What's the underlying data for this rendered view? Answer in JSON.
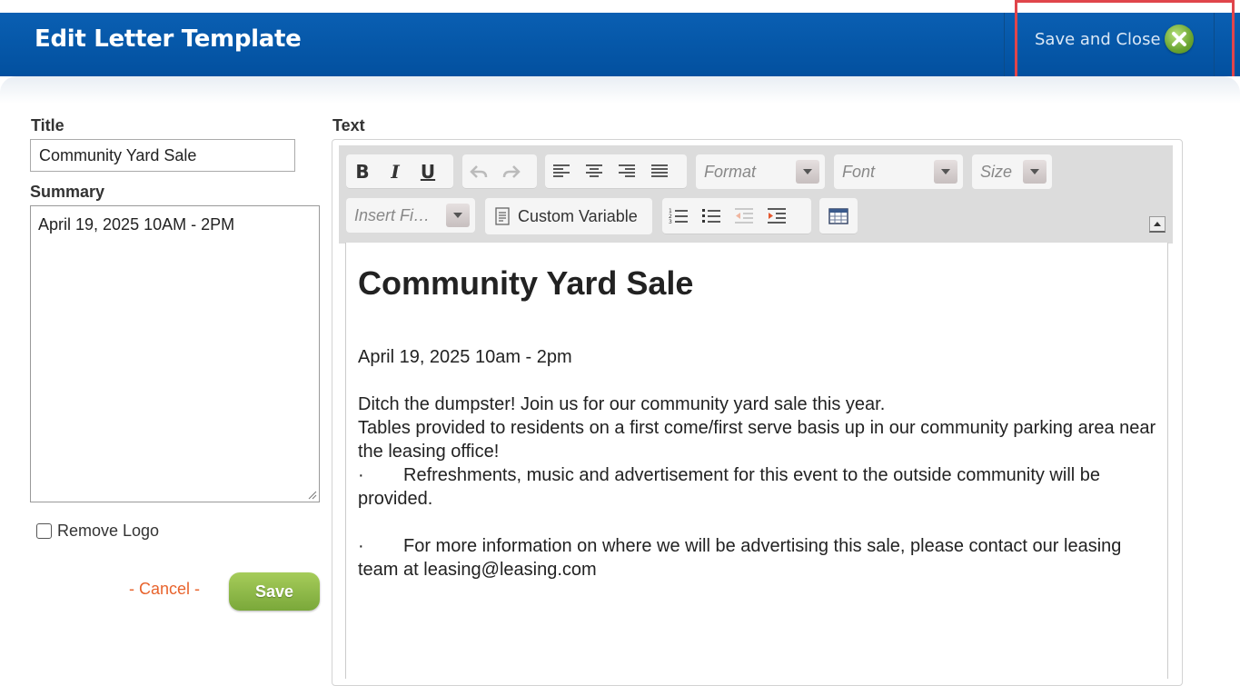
{
  "header": {
    "title": "Edit Letter Template",
    "save_close_label": "Save and Close",
    "close_icon": "close-circle-icon",
    "accent": "#02509f"
  },
  "form": {
    "title_label": "Title",
    "title_value": "Community Yard Sale",
    "summary_label": "Summary",
    "summary_value": "April 19, 2025 10AM - 2PM",
    "remove_logo_label": "Remove Logo",
    "remove_logo_checked": false,
    "cancel_label": "- Cancel -",
    "save_label": "Save"
  },
  "editor": {
    "label": "Text",
    "toolbar": {
      "format_placeholder": "Format",
      "font_placeholder": "Font",
      "size_placeholder": "Size",
      "insert_field_placeholder": "Insert Fi…",
      "custom_variable_label": "Custom Variable",
      "icons": [
        "bold-icon",
        "italic-icon",
        "underline-icon",
        "undo-icon",
        "redo-icon",
        "align-left-icon",
        "align-center-icon",
        "align-right-icon",
        "justify-icon",
        "numbered-list-icon",
        "bulleted-list-icon",
        "outdent-icon",
        "indent-icon",
        "table-icon"
      ]
    },
    "content": {
      "heading": "Community Yard Sale",
      "date_line": "April 19, 2025 10am - 2pm",
      "para1": "Ditch the dumpster! Join us for our community yard sale this year.",
      "para2": "Tables provided to residents on a first come/first serve basis up in our community parking area near the leasing office!",
      "bullet1": "Refreshments, music and advertisement for this event to the outside community will be provided.",
      "bullet2": "For more information on where we will be advertising this sale, please contact our leasing team at leasing@leasing.com",
      "bullet_char": "·"
    }
  }
}
